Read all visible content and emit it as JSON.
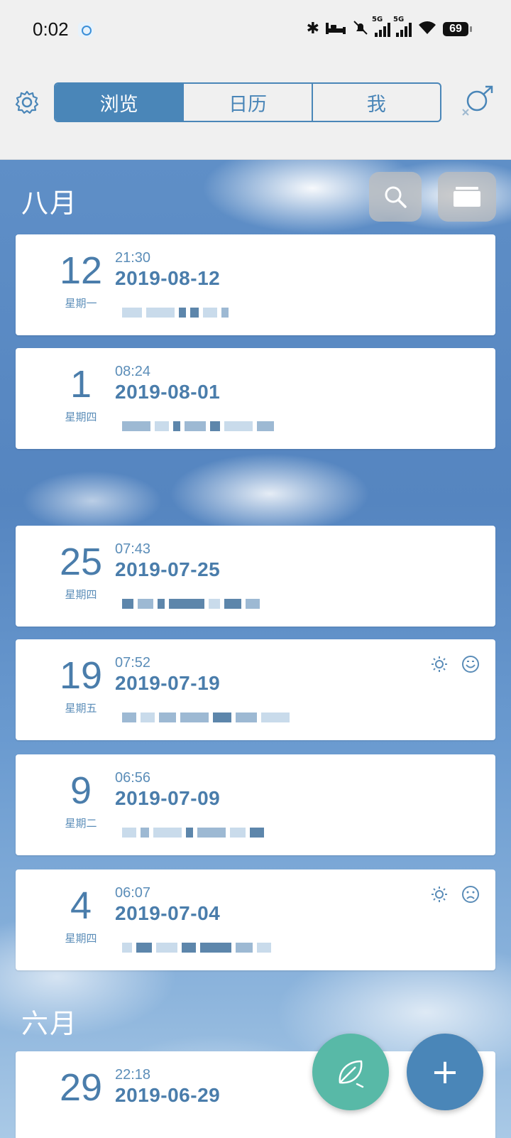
{
  "status_bar": {
    "time": "0:02",
    "icons": [
      "notification-app-icon",
      "bluetooth-icon",
      "bed-icon",
      "mute-icon",
      "signal-5g-icon",
      "signal-5g-icon",
      "wifi-icon",
      "battery-icon"
    ],
    "network_tag_1": "5G",
    "network_tag_2": "5G",
    "battery_level": "69"
  },
  "header": {
    "tabs": [
      {
        "label": "浏览",
        "active": true
      },
      {
        "label": "日历",
        "active": false
      },
      {
        "label": "我",
        "active": false
      }
    ],
    "settings_icon": "gear-icon",
    "gender_icon": "gender-icon"
  },
  "sections": [
    {
      "month": "八月",
      "entries": [
        {
          "day": "12",
          "weekday": "星期一",
          "time": "21:30",
          "date": "2019-08-12",
          "weather_icon": false,
          "mood_icon": ""
        },
        {
          "day": "1",
          "weekday": "星期四",
          "time": "08:24",
          "date": "2019-08-01",
          "weather_icon": false,
          "mood_icon": ""
        },
        {
          "day": "25",
          "weekday": "星期四",
          "time": "07:43",
          "date": "2019-07-25",
          "weather_icon": false,
          "mood_icon": ""
        },
        {
          "day": "19",
          "weekday": "星期五",
          "time": "07:52",
          "date": "2019-07-19",
          "weather_icon": true,
          "mood_icon": "happy"
        },
        {
          "day": "9",
          "weekday": "星期二",
          "time": "06:56",
          "date": "2019-07-09",
          "weather_icon": false,
          "mood_icon": ""
        },
        {
          "day": "4",
          "weekday": "星期四",
          "time": "06:07",
          "date": "2019-07-04",
          "weather_icon": true,
          "mood_icon": "sad"
        }
      ]
    },
    {
      "month": "六月",
      "entries": [
        {
          "day": "29",
          "weekday": "",
          "time": "22:18",
          "date": "2019-06-29"
        }
      ]
    }
  ],
  "buttons": {
    "search": "search-icon",
    "archive": "folder-icon",
    "fab_leaf": "leaf-icon",
    "fab_add": "+"
  }
}
